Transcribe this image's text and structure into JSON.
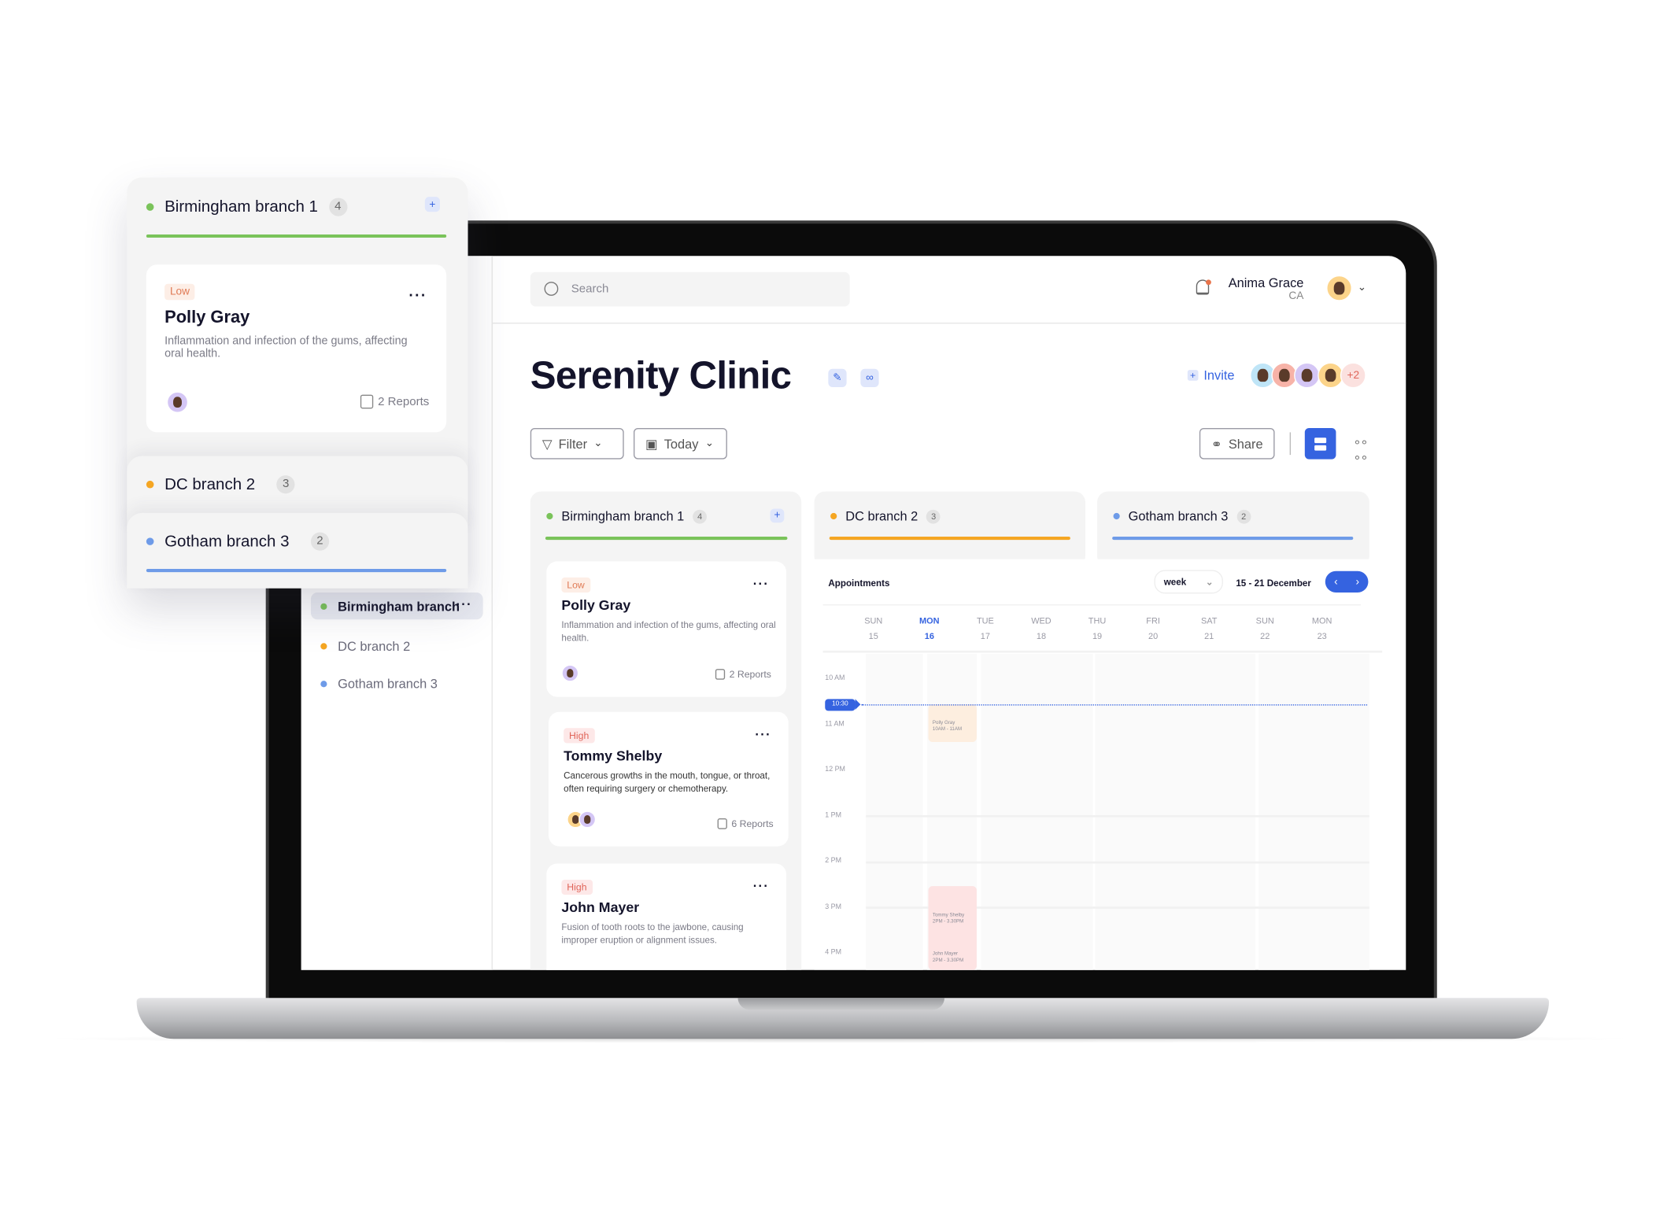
{
  "colors": {
    "accent": "#3563e0",
    "green": "#7ac35a",
    "orange": "#f5a623",
    "blue": "#6e9be8"
  },
  "sidebar": {
    "items": [
      {
        "label": "Birmingham branch",
        "color": "#7ac35a",
        "active": true,
        "more": "···"
      },
      {
        "label": "DC branch 2",
        "color": "#f5a623"
      },
      {
        "label": "Gotham branch 3",
        "color": "#6e9be8"
      }
    ]
  },
  "header": {
    "search_placeholder": "Search",
    "user_name": "Anima Grace",
    "user_role": "CA",
    "notification_icon": "bell-icon"
  },
  "page": {
    "title": "Serenity Clinic",
    "invite_label": "Invite",
    "members_extra": "+2"
  },
  "toolbar": {
    "filter_label": "Filter",
    "date_label": "Today",
    "share_label": "Share"
  },
  "columns": [
    {
      "name": "Birmingham branch 1",
      "count": "4",
      "color": "#7ac35a"
    },
    {
      "name": "DC branch 2",
      "count": "3",
      "color": "#f5a623"
    },
    {
      "name": "Gotham branch 3",
      "count": "2",
      "color": "#6e9be8"
    }
  ],
  "cards": [
    {
      "priority": "Low",
      "name": "Polly Gray",
      "description": "Inflammation and infection of the gums, affecting oral health.",
      "reports": "2 Reports"
    },
    {
      "priority": "High",
      "name": "Tommy Shelby",
      "description": "Cancerous growths in the mouth, tongue, or throat, often requiring surgery or chemotherapy.",
      "reports": "6 Reports"
    },
    {
      "priority": "High",
      "name": "John Mayer",
      "description": "Fusion of tooth roots to the jawbone, causing improper eruption or alignment issues."
    }
  ],
  "calendar": {
    "title": "Appointments",
    "view": "week",
    "range": "15 - 21 December",
    "current_time": "10:30",
    "days": [
      {
        "d": "SUN",
        "n": "15"
      },
      {
        "d": "MON",
        "n": "16",
        "today": true
      },
      {
        "d": "TUE",
        "n": "17"
      },
      {
        "d": "WED",
        "n": "18"
      },
      {
        "d": "THU",
        "n": "19"
      },
      {
        "d": "FRI",
        "n": "20"
      },
      {
        "d": "SAT",
        "n": "21"
      },
      {
        "d": "SUN",
        "n": "22"
      },
      {
        "d": "MON",
        "n": "23"
      }
    ],
    "times": [
      "10 AM",
      "11 AM",
      "12 PM",
      "1 PM",
      "2 PM",
      "3 PM",
      "4 PM"
    ],
    "events": [
      {
        "name": "Polly Gray",
        "time": "10AM - 11AM"
      },
      {
        "name": "Tommy Shelby",
        "time": "2PM - 3.30PM"
      },
      {
        "name": "John Mayer",
        "time": "2PM - 3.30PM"
      }
    ]
  }
}
